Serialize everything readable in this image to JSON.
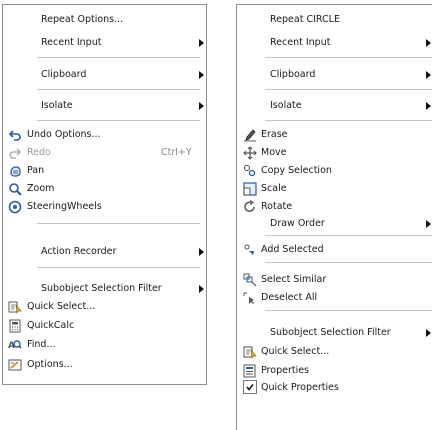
{
  "left_menu": {
    "repeat_options": "Repeat Options...",
    "recent_input": "Recent Input",
    "clipboard": "Clipboard",
    "isolate": "Isolate",
    "undo_options": "Undo Options...",
    "redo": "Redo",
    "redo_shortcut": "Ctrl+Y",
    "pan": "Pan",
    "zoom": "Zoom",
    "steering_wheels": "SteeringWheels",
    "action_recorder": "Action Recorder",
    "subobject_filter": "Subobject Selection Filter",
    "quick_select": "Quick Select...",
    "quickcalc": "QuickCalc",
    "find": "Find...",
    "options": "Options..."
  },
  "right_menu": {
    "repeat": "Repeat CIRCLE",
    "recent_input": "Recent Input",
    "clipboard": "Clipboard",
    "isolate": "Isolate",
    "erase": "Erase",
    "move": "Move",
    "copy_selection": "Copy Selection",
    "scale": "Scale",
    "rotate": "Rotate",
    "draw_order": "Draw Order",
    "add_selected": "Add Selected",
    "select_similar": "Select Similar",
    "deselect_all": "Deselect All",
    "subobject_filter": "Subobject Selection Filter",
    "quick_select": "Quick Select...",
    "properties": "Properties",
    "quick_properties": "Quick Properties"
  },
  "colors": {
    "border": "#8d8d8d",
    "separator": "#c7c7c7",
    "icon_blue": "#2a5aa8",
    "icon_gray": "#555555"
  }
}
